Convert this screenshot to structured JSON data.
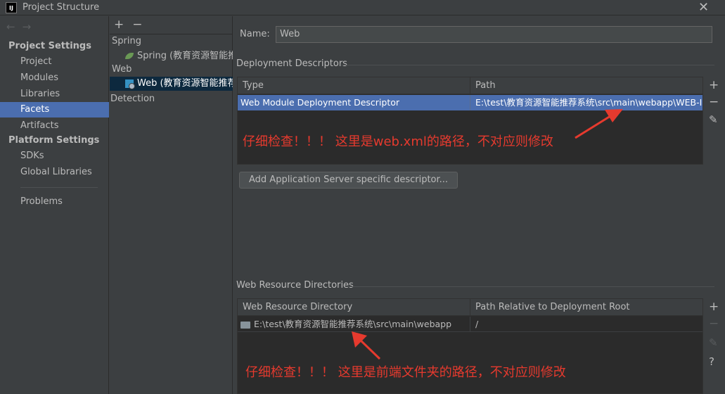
{
  "window": {
    "app_icon": "IJ",
    "title": "Project Structure",
    "close": "✕"
  },
  "nav": {
    "back": "←",
    "forward": "→"
  },
  "sidebar": {
    "project_settings_header": "Project Settings",
    "project_items": [
      {
        "label": "Project"
      },
      {
        "label": "Modules"
      },
      {
        "label": "Libraries"
      },
      {
        "label": "Facets"
      },
      {
        "label": "Artifacts"
      }
    ],
    "platform_settings_header": "Platform Settings",
    "platform_items": [
      {
        "label": "SDKs"
      },
      {
        "label": "Global Libraries"
      }
    ],
    "problems": "Problems",
    "selected": "Facets"
  },
  "facets": {
    "add": "+",
    "remove": "−",
    "groups": [
      {
        "label": "Spring",
        "child": "Spring (教育资源智能推荐"
      },
      {
        "label": "Web",
        "child": "Web (教育资源智能推荐系"
      }
    ],
    "detection": "Detection"
  },
  "form": {
    "name_label": "Name:",
    "name_value": "Web",
    "deployment": {
      "title": "Deployment Descriptors",
      "columns": [
        "Type",
        "Path"
      ],
      "row": {
        "type": "Web Module Deployment Descriptor",
        "path": "E:\\test\\教育资源智能推荐系统\\src\\main\\webapp\\WEB-INF"
      },
      "add_button": "Add Application Server specific descriptor..."
    },
    "resources": {
      "title": "Web Resource Directories",
      "columns": [
        "Web Resource Directory",
        "Path Relative to Deployment Root"
      ],
      "row": {
        "directory": "E:\\test\\教育资源智能推荐系统\\src\\main\\webapp",
        "relative": "/"
      }
    },
    "tools": {
      "add": "+",
      "remove": "−",
      "edit": "✎",
      "help": "?"
    }
  },
  "annotations": {
    "top": "仔细检查！！！ 这里是web.xml的路径，不对应则修改",
    "bottom": "仔细检查！！！ 这里是前端文件夹的路径，不对应则修改",
    "color": "#e63a2e"
  },
  "colors": {
    "selection": "#4b6eaf",
    "background": "#3c3f41",
    "table": "#2b2b2b"
  }
}
